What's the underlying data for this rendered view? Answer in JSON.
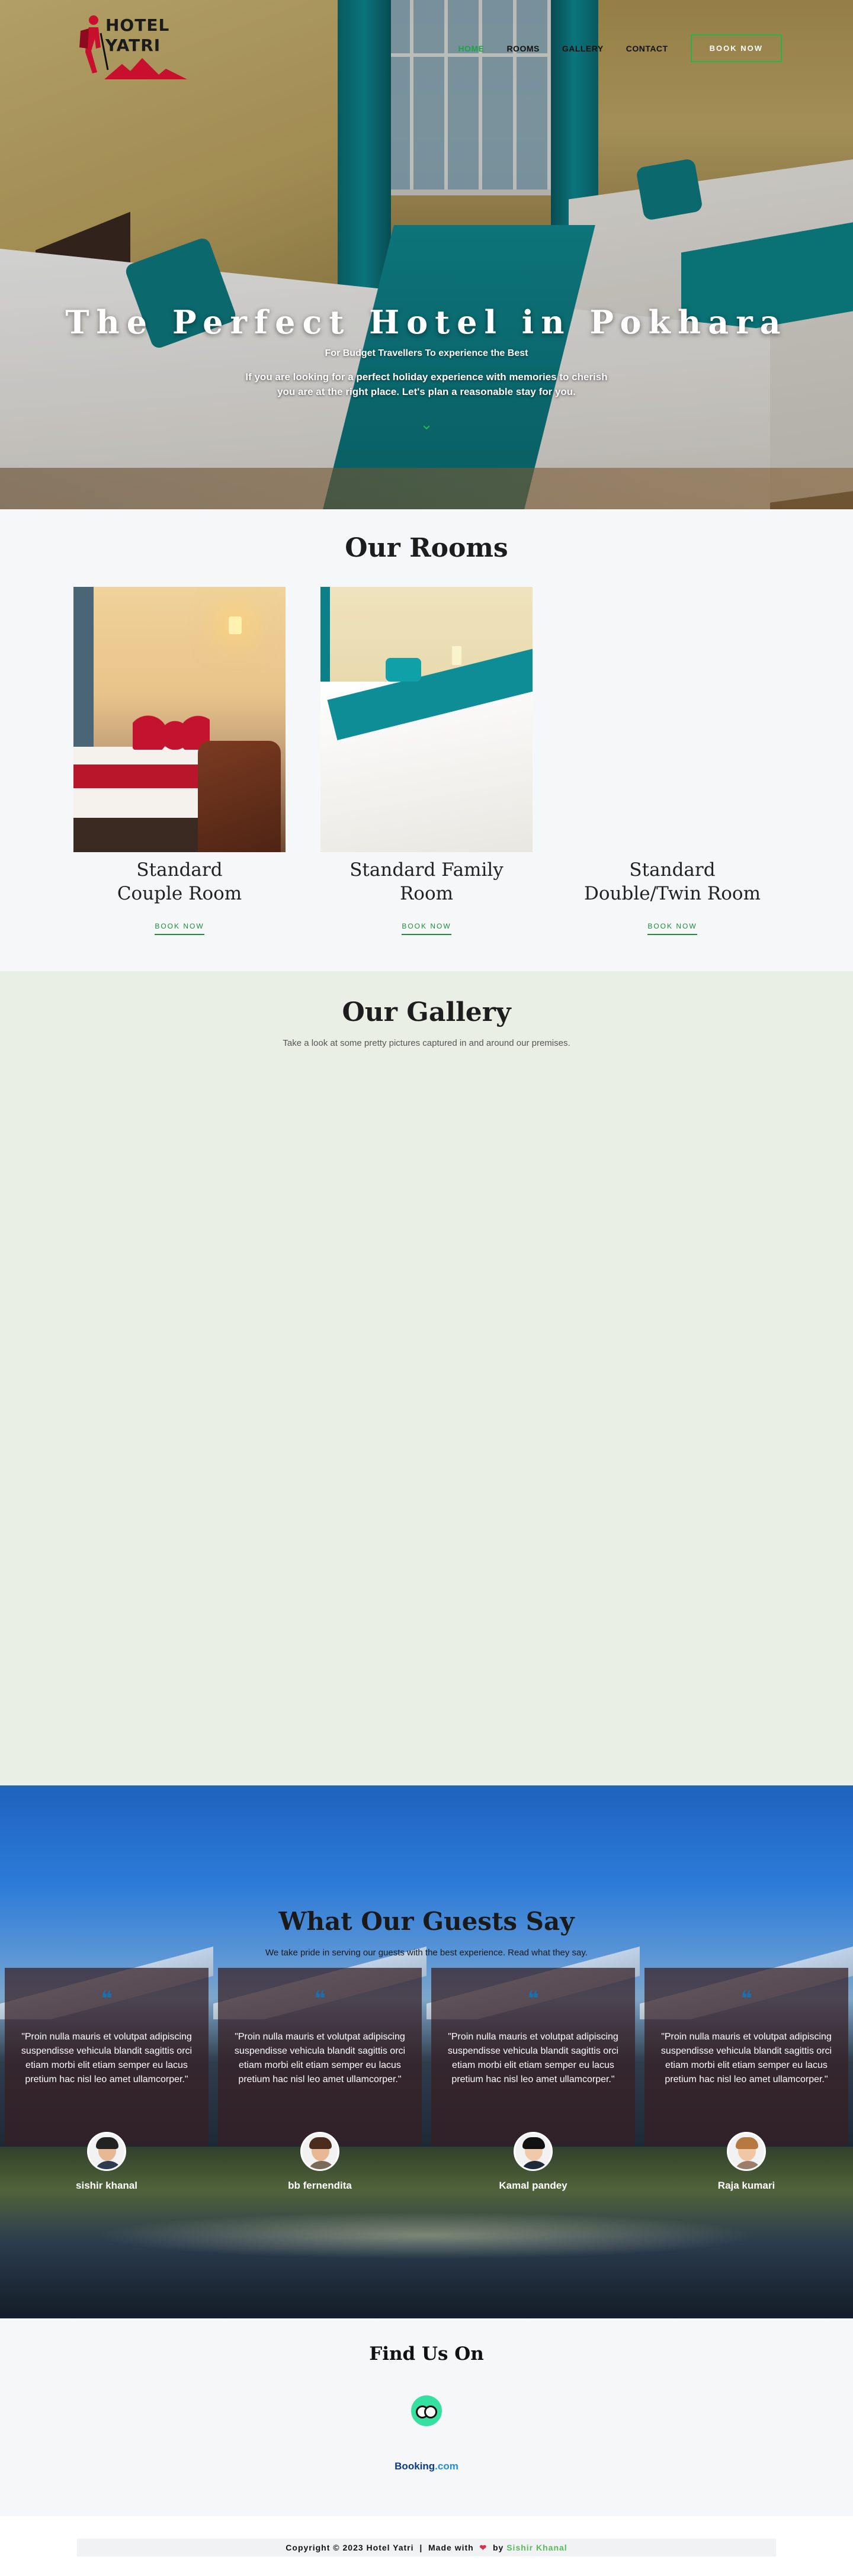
{
  "brand": {
    "line1": "HOTEL",
    "line2": "YATRI"
  },
  "nav": {
    "items": [
      {
        "label": "HOME"
      },
      {
        "label": "ROOMS"
      },
      {
        "label": "GALLERY"
      },
      {
        "label": "CONTACT"
      }
    ],
    "book_label": "BOOK NOW"
  },
  "hero": {
    "title": "The Perfect Hotel in Pokhara",
    "subtitle": "For Budget Travellers To experience the Best",
    "description": "If you are looking for a perfect holiday experience with memories to cherish you are at the right place. Let's plan a reasonable stay for you.",
    "scroll_icon": "chevron-down-icon"
  },
  "rooms": {
    "title": "Our Rooms",
    "items": [
      {
        "name": "Standard Couple Room",
        "book_label": "BOOK NOW"
      },
      {
        "name": "Standard Family Room",
        "book_label": "BOOK NOW"
      },
      {
        "name": "Standard Double/Twin Room",
        "book_label": "BOOK NOW"
      }
    ]
  },
  "gallery": {
    "title": "Our Gallery",
    "lead": "Take a look at some pretty pictures captured in and around our premises."
  },
  "testimonials": {
    "title": "What Our Guests Say",
    "lead": "We take pride in serving our guests with the best experience. Read what they say.",
    "items": [
      {
        "quote": "\"Proin nulla mauris et volutpat adipiscing suspendisse vehicula blandit sagittis orci etiam morbi elit etiam semper eu lacus pretium hac nisl leo amet ullamcorper.\"",
        "name": "sishir khanal"
      },
      {
        "quote": "\"Proin nulla mauris et volutpat adipiscing suspendisse vehicula blandit sagittis orci etiam morbi elit etiam semper eu lacus pretium hac nisl leo amet ullamcorper.\"",
        "name": "bb fernendita"
      },
      {
        "quote": "\"Proin nulla mauris et volutpat adipiscing suspendisse vehicula blandit sagittis orci etiam morbi elit etiam semper eu lacus pretium hac nisl leo amet ullamcorper.\"",
        "name": "Kamal pandey"
      },
      {
        "quote": "\"Proin nulla mauris et volutpat adipiscing suspendisse vehicula blandit sagittis orci etiam morbi elit etiam semper eu lacus pretium hac nisl leo amet ullamcorper.\"",
        "name": "Raja kumari"
      }
    ]
  },
  "findus": {
    "title": "Find Us On",
    "tripadvisor_icon": "tripadvisor-owl-icon",
    "booking": {
      "part1": "Booking",
      "part2": ".com"
    }
  },
  "footer": {
    "copyright": "Copyright © 2023 Hotel Yatri",
    "separator": "|",
    "made_with": "Made with",
    "heart": "❤",
    "by": "by",
    "author": "Sishir Khanal"
  },
  "colors": {
    "accent": "#25b34a",
    "teal": "#0e8f98",
    "dark": "#1d1d1d"
  }
}
